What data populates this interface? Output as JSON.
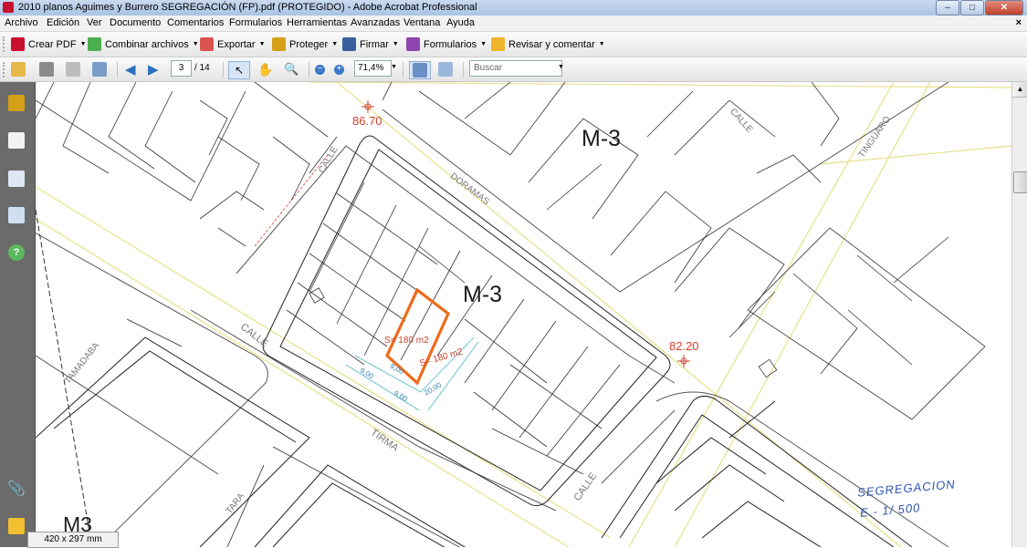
{
  "window": {
    "title": "2010 planos Aguimes y Burrero SEGREGACIÓN (FP).pdf (PROTEGIDO) - Adobe Acrobat Professional",
    "minimize": "–",
    "maximize": "□",
    "close": "✕"
  },
  "menu": {
    "items": [
      "Archivo",
      "Edición",
      "Ver",
      "Documento",
      "Comentarios",
      "Formularios",
      "Herramientas",
      "Avanzadas",
      "Ventana",
      "Ayuda"
    ],
    "close_doc": "×"
  },
  "toolbar1": {
    "create_pdf": "Crear PDF",
    "combine": "Combinar archivos",
    "export": "Exportar",
    "protect": "Proteger",
    "sign": "Firmar",
    "forms": "Formularios",
    "review": "Revisar y comentar"
  },
  "toolbar2": {
    "current_page": "3",
    "total_pages": "/ 14",
    "zoom": "71,4%",
    "search_placeholder": "Buscar"
  },
  "document": {
    "labels": {
      "m3_top": "M-3",
      "m3_center": "M-3",
      "m3_bottom": "M3",
      "elev_1": "86.70",
      "elev_2": "82.20",
      "street_calle_1": "CALLE",
      "street_calle_2": "CALLE",
      "street_calle_3": "CALLE",
      "street_calle_4": "CALLE",
      "street_doramas": "DORAMAS",
      "street_tinguaro": "TINGÜARO",
      "street_tirma": "TIRMA",
      "street_tamadaba": "TAMADABA",
      "street_tara": "TARA",
      "area_1": "S= 180 m2",
      "area_2": "S= 180 m2",
      "dim_1": "9,00",
      "dim_2": "9,00",
      "dim_3": "9,00",
      "dim_4": "20,00",
      "handwritten_1": "SEGREGACION",
      "handwritten_2": "E.- 1/ 500"
    }
  },
  "status": {
    "page_size": "420 x 297 mm"
  },
  "colors": {
    "plot_orange": "#ee6a1a",
    "elevation_red": "#d0402a",
    "handwriting_blue": "#2d55b0",
    "lines": "#333333",
    "street_yellow": "#e8e08a"
  }
}
